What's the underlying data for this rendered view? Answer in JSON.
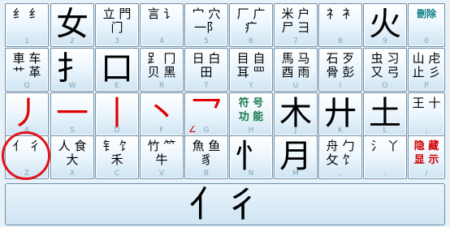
{
  "keyboard": {
    "rows": [
      [
        {
          "name": "key-1",
          "top": "纟 纟",
          "hint": "1"
        },
        {
          "name": "key-2",
          "big": "女",
          "hint": "2"
        },
        {
          "name": "key-3",
          "top": "立 門\n 门",
          "hint": "3"
        },
        {
          "name": "key-4",
          "top": "言 讠",
          "hint": "4"
        },
        {
          "name": "key-5",
          "top": "宀 穴\n一阝",
          "hint": "5"
        },
        {
          "name": "key-6",
          "top": "厂 广\n 疒",
          "hint": "6"
        },
        {
          "name": "key-7",
          "top": "米 户\n尸 彐",
          "hint": "7"
        },
        {
          "name": "key-8",
          "top": "礻 衤",
          "hint": "8"
        },
        {
          "name": "key-9",
          "big": "火",
          "hint": "9"
        },
        {
          "name": "key-0",
          "top": "刪除",
          "hint": "0",
          "style": "teal"
        }
      ],
      [
        {
          "name": "key-q",
          "top": "車 车\n艹 革",
          "hint": "Q"
        },
        {
          "name": "key-w",
          "big": "扌",
          "hint": "W"
        },
        {
          "name": "key-e",
          "big": "口",
          "hint": "E"
        },
        {
          "name": "key-r",
          "top": "𧾷 冂\n贝 黑",
          "hint": "R"
        },
        {
          "name": "key-t",
          "top": "日 白\n 田",
          "hint": "T"
        },
        {
          "name": "key-y",
          "top": "目 自\n耳 罒",
          "hint": "Y"
        },
        {
          "name": "key-u",
          "top": "馬 马\n酉 雨",
          "hint": "U"
        },
        {
          "name": "key-i",
          "top": "石 歹\n骨 彭",
          "hint": "I"
        },
        {
          "name": "key-o",
          "top": "虫 习\n又 弓",
          "hint": "O"
        },
        {
          "name": "key-p",
          "top": "山 虍\n止 彡",
          "hint": "P"
        }
      ],
      [
        {
          "name": "key-a",
          "big": "丿",
          "hint": "A",
          "red": true
        },
        {
          "name": "key-s",
          "big": "一",
          "hint": "S",
          "red": true
        },
        {
          "name": "key-d",
          "big": "丨",
          "hint": "D",
          "red": true
        },
        {
          "name": "key-f",
          "big": "丶",
          "hint": "F",
          "red": true
        },
        {
          "name": "key-g",
          "big": "乛",
          "hint": "G",
          "red": true,
          "sub": "∠"
        },
        {
          "name": "key-h",
          "top": "符 号\n功 能",
          "hint": "H",
          "style": "green"
        },
        {
          "name": "key-j",
          "big": "木",
          "hint": "J"
        },
        {
          "name": "key-k",
          "big": "廾",
          "hint": "K"
        },
        {
          "name": "key-l",
          "big": "土",
          "hint": "L"
        },
        {
          "name": "key-semicolon",
          "top": "王 十",
          "hint": ";"
        }
      ],
      [
        {
          "name": "key-z",
          "top": "亻 彳",
          "hint": "Z"
        },
        {
          "name": "key-x",
          "top": "人 食\n 大",
          "hint": "X"
        },
        {
          "name": "key-c",
          "top": "钅 饣\n 禾",
          "hint": "C"
        },
        {
          "name": "key-v",
          "top": "竹 ⺮\n 牛",
          "hint": "V"
        },
        {
          "name": "key-b",
          "top": "魚 鱼\n 豸",
          "hint": "B"
        },
        {
          "name": "key-n",
          "big": "忄",
          "hint": "N"
        },
        {
          "name": "key-m",
          "big": "月",
          "hint": "M"
        },
        {
          "name": "key-comma",
          "top": "舟 勹\n 攵 饣",
          "hint": ","
        },
        {
          "name": "key-period",
          "top": "氵 丫",
          "hint": "."
        },
        {
          "name": "key-slash",
          "top": "隐 藏\n显 示",
          "hint": "/",
          "style": "red"
        }
      ]
    ],
    "preview": "亻彳"
  }
}
